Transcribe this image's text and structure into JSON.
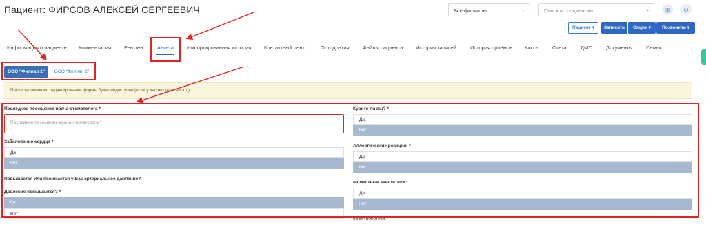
{
  "header": {
    "title": "Пациент: ФИРСОВ АЛЕКСЕЙ СЕРГЕЕВИЧ",
    "branch_select": "Все филиалы",
    "patient_search_placeholder": "Поиск по пациентам"
  },
  "actions": {
    "patient": "Пациент ▾",
    "record": "Записать",
    "options": "Опции ▾",
    "call": "Позвонить ▾"
  },
  "tabs": [
    "Информация о пациенте",
    "Комментарии",
    "Рентген",
    "Анкета",
    "Импортированная история",
    "Контактный центр",
    "Ортодонтия",
    "Файлы пациента",
    "История записей",
    "История приёмов",
    "Касса",
    "Счета",
    "ДМС",
    "Документы",
    "Семья"
  ],
  "branches": [
    "ООО \"Филиал 1\"",
    "ООО \"Филиал 2\""
  ],
  "notice": "После заполнения, редактирование формы будет недоступно (если у вас нет прав на это).",
  "form": {
    "last_visit": {
      "label": "Последнее посещение врача-стоматолога *",
      "placeholder": "Последнее посещение врача-стоматолога *"
    },
    "heart_disease": {
      "label": "Заболевание сердца *",
      "yes": "Да",
      "no": "Нет"
    },
    "pressure_question": "Повышается или понижается у Вас артериальное давление?",
    "pressure_up": {
      "label": "Давление повышается? *",
      "yes": "Да",
      "no": "Нет"
    },
    "smoking": {
      "label": "Курите ли вы? *",
      "yes": "Да",
      "no": "Нет"
    },
    "allergic": {
      "label": "Аллергические реакции: *",
      "yes": "Да",
      "no": "Нет"
    },
    "anesthetics": {
      "label": "на местные анестетики *",
      "yes": "Да",
      "no": "Нет"
    },
    "antibiotics_label": "на антибиотики *"
  }
}
